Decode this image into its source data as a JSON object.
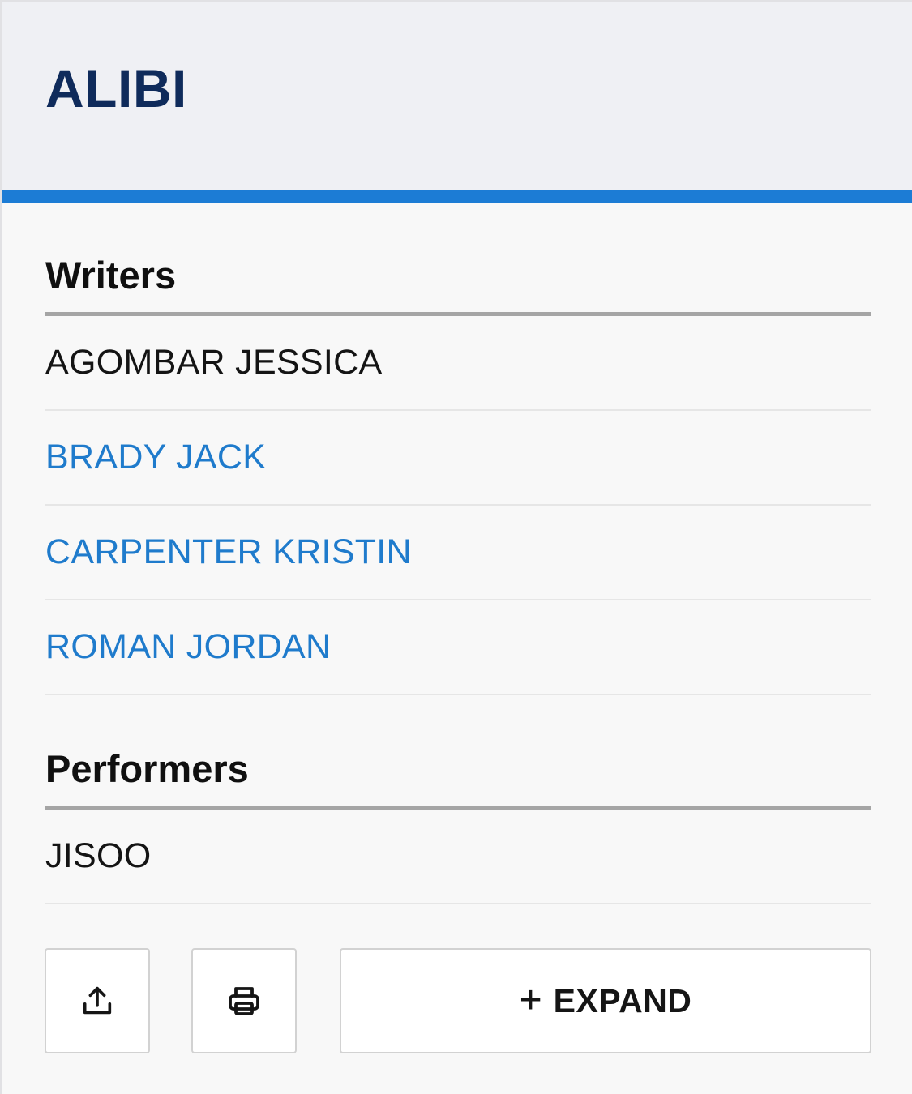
{
  "title": "ALIBI",
  "writers": {
    "heading": "Writers",
    "items": [
      {
        "name": "AGOMBAR JESSICA",
        "link": false
      },
      {
        "name": "BRADY JACK",
        "link": true
      },
      {
        "name": "CARPENTER KRISTIN",
        "link": true
      },
      {
        "name": "ROMAN JORDAN",
        "link": true
      }
    ]
  },
  "performers": {
    "heading": "Performers",
    "items": [
      {
        "name": "JISOO",
        "link": false
      }
    ]
  },
  "actions": {
    "share_icon": "share-upload-icon",
    "print_icon": "printer-icon",
    "expand_symbol": "+",
    "expand_label": "EXPAND"
  },
  "colors": {
    "title": "#0f2b5b",
    "accent": "#1c7cd5",
    "link": "#1f7bcc"
  }
}
